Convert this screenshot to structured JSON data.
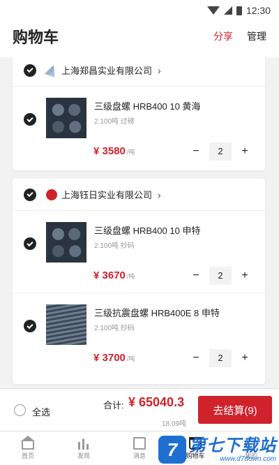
{
  "status_bar": {
    "time": "12:30"
  },
  "header": {
    "title": "购物车",
    "share": "分享",
    "manage": "管理"
  },
  "shops": [
    {
      "name": "上海郑昌实业有限公司",
      "items": [
        {
          "name": "三级盘螺 HRB400 10 黄海",
          "meta": "2.100吨 过磅",
          "price": "¥ 3580",
          "unit": "/吨",
          "qty": "2"
        }
      ]
    },
    {
      "name": "上海钰日实业有限公司",
      "items": [
        {
          "name": "三级盘螺 HRB400 10 申特",
          "meta": "2.100吨 抄码",
          "price": "¥ 3670",
          "unit": "/吨",
          "qty": "2"
        },
        {
          "name": "三级抗震盘螺 HRB400E 8 申特",
          "meta": "2.100吨 抄码",
          "price": "¥ 3700",
          "unit": "/吨",
          "qty": "2"
        }
      ]
    }
  ],
  "qty_controls": {
    "minus": "−",
    "plus": "+"
  },
  "checkout": {
    "select_all": "全选",
    "total_label": "合计:",
    "total_amount": "¥ 65040.3",
    "total_weight": "18.09吨",
    "button": "去结算(9)"
  },
  "tabs": [
    {
      "label": "首页",
      "icon": "home-icon"
    },
    {
      "label": "发现",
      "icon": "discover-icon"
    },
    {
      "label": "消息",
      "icon": "message-icon"
    },
    {
      "label": "购物车",
      "icon": "cart-icon",
      "active": true
    },
    {
      "label": "我的",
      "icon": "profile-icon"
    }
  ],
  "watermark": {
    "logo": "7",
    "text": "第七下载站",
    "url": "www.d7down.com"
  },
  "colors": {
    "accent": "#d0222b",
    "watermark": "#1f6fd1"
  }
}
